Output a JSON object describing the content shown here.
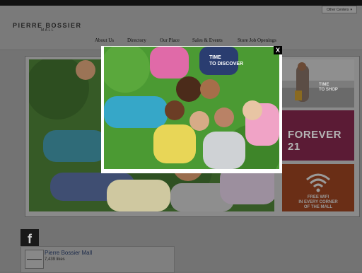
{
  "header": {
    "other_centers": "Other Centers",
    "logo_main": "PIERRE BOSSIER",
    "logo_sub": "MALL"
  },
  "nav": [
    "About Us",
    "Directory",
    "Our Place",
    "Sales & Events",
    "Store Job Openings"
  ],
  "promos": {
    "shop": [
      "TIME",
      "TO SHOP"
    ],
    "forever": "FOREVER 21",
    "wifi": [
      "FREE WIFI",
      "IN EVERY CORNER",
      "OF THE MALL"
    ]
  },
  "facebook": {
    "name": "Pierre Bossier Mall",
    "likes": "7,439 likes",
    "icon_text": "f"
  },
  "modal": {
    "caption": [
      "TIME",
      "TO DISCOVER"
    ],
    "close": "X"
  }
}
